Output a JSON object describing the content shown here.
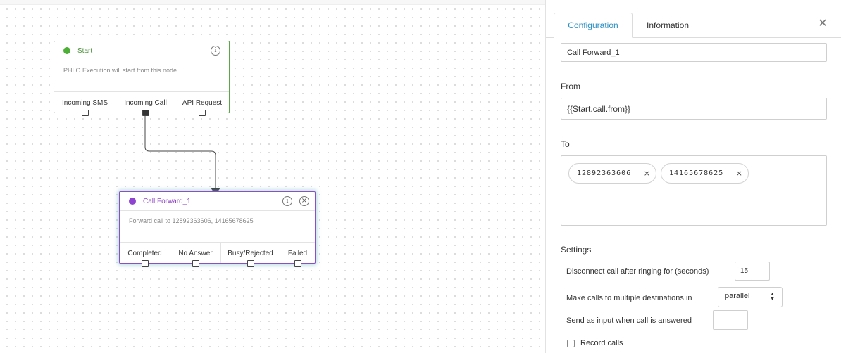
{
  "canvas": {
    "start_node": {
      "title": "Start",
      "description": "PHLO Execution will start from this node",
      "outputs": [
        "Incoming SMS",
        "Incoming Call",
        "API Request"
      ]
    },
    "call_forward_node": {
      "title": "Call Forward_1",
      "description": "Forward call to 12892363606, 14165678625",
      "outputs": [
        "Completed",
        "No Answer",
        "Busy/Rejected",
        "Failed"
      ]
    }
  },
  "panel": {
    "tabs": [
      "Configuration",
      "Information"
    ],
    "active_tab": "Configuration",
    "name_value": "Call Forward_1",
    "from_label": "From",
    "from_value": "{{Start.call.from}}",
    "to_label": "To",
    "to_numbers": [
      "12892363606",
      "14165678625"
    ],
    "chip_remove": "×",
    "settings_label": "Settings",
    "disconnect_label": "Disconnect call after ringing for (seconds)",
    "disconnect_value": "15",
    "multi_label": "Make calls to multiple destinations in",
    "multi_value": "parallel",
    "send_input_label": "Send as input when call is answered",
    "send_input_value": "",
    "record_label": "Record calls",
    "record_checked": false
  },
  "colors": {
    "start_accent": "#4caf36",
    "call_forward_accent": "#8e44d0",
    "active_tab": "#2b8fc4"
  }
}
